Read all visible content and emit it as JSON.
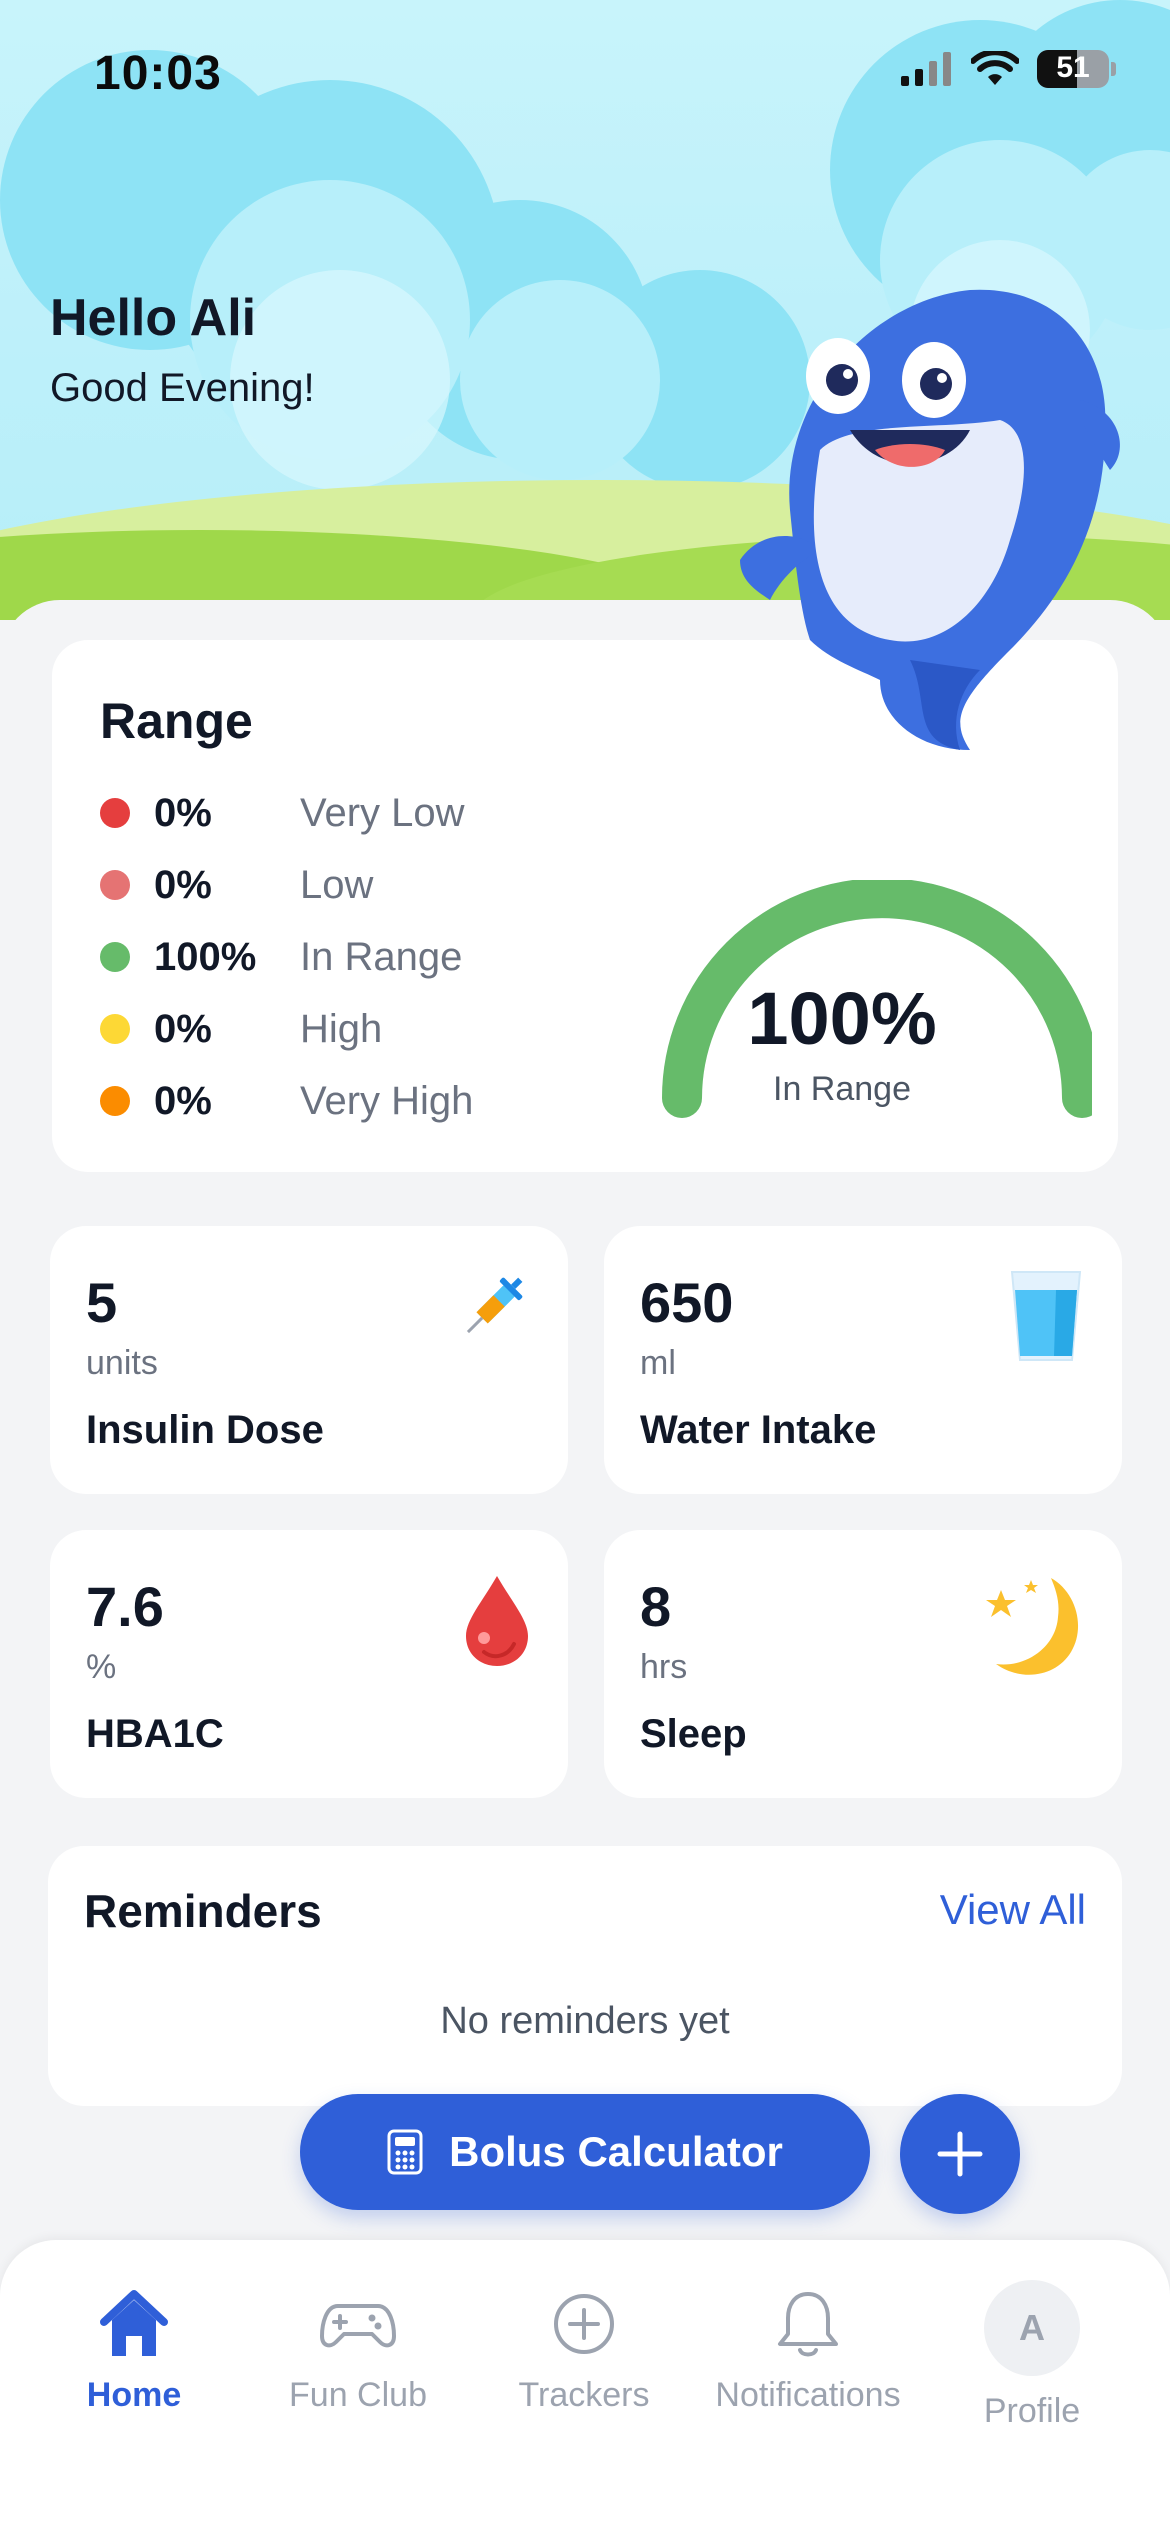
{
  "status_bar": {
    "time": "10:03",
    "battery": "51"
  },
  "greeting": {
    "title": "Hello Ali",
    "subtitle": "Good Evening!"
  },
  "range": {
    "title": "Range",
    "rows": [
      {
        "pct": "0%",
        "label": "Very Low",
        "color": "#e53e3e"
      },
      {
        "pct": "0%",
        "label": "Low",
        "color": "#e57373"
      },
      {
        "pct": "100%",
        "label": "In Range",
        "color": "#66bb6a"
      },
      {
        "pct": "0%",
        "label": "High",
        "color": "#fdd835"
      },
      {
        "pct": "0%",
        "label": "Very High",
        "color": "#fb8c00"
      }
    ],
    "gauge_value": "100%",
    "gauge_label": "In Range",
    "gauge_fraction": 1.0
  },
  "metrics": [
    {
      "value": "5",
      "unit": "units",
      "name": "Insulin Dose",
      "icon": "syringe-icon"
    },
    {
      "value": "650",
      "unit": "ml",
      "name": "Water Intake",
      "icon": "water-glass-icon"
    },
    {
      "value": "7.6",
      "unit": "%",
      "name": "HBA1C",
      "icon": "blood-drop-icon"
    },
    {
      "value": "8",
      "unit": "hrs",
      "name": "Sleep",
      "icon": "moon-stars-icon"
    }
  ],
  "reminders": {
    "title": "Reminders",
    "view_all": "View All",
    "empty": "No reminders yet"
  },
  "bolus": {
    "label": "Bolus Calculator"
  },
  "tabs": [
    {
      "label": "Home",
      "icon": "home-icon",
      "active": true
    },
    {
      "label": "Fun Club",
      "icon": "gamepad-icon",
      "active": false
    },
    {
      "label": "Trackers",
      "icon": "plus-circle-icon",
      "active": false
    },
    {
      "label": "Notifications",
      "icon": "bell-icon",
      "active": false
    },
    {
      "label": "Profile",
      "icon": "avatar-icon",
      "active": false,
      "initial": "A"
    }
  ],
  "colors": {
    "accent": "#2f5fd8",
    "in_range": "#66bb6a"
  }
}
